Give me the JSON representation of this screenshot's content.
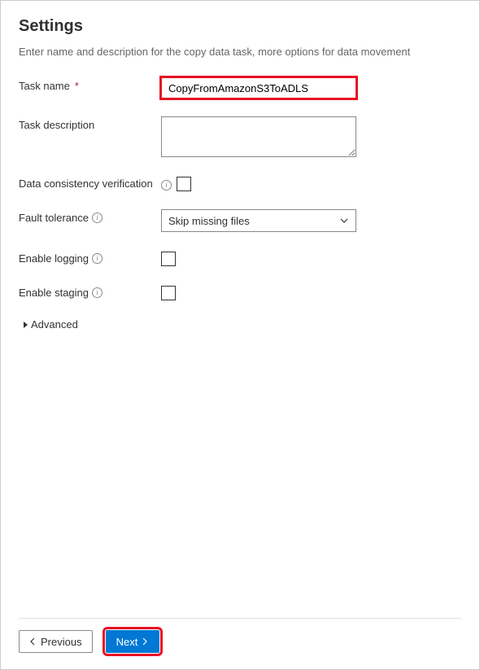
{
  "header": {
    "title": "Settings",
    "subtitle": "Enter name and description for the copy data task, more options for data movement"
  },
  "fields": {
    "taskName": {
      "label": "Task name",
      "value": "CopyFromAmazonS3ToADLS"
    },
    "taskDescription": {
      "label": "Task description",
      "value": ""
    },
    "dataConsistency": {
      "label": "Data consistency verification",
      "checked": false
    },
    "faultTolerance": {
      "label": "Fault tolerance",
      "selected": "Skip missing files"
    },
    "enableLogging": {
      "label": "Enable logging",
      "checked": false
    },
    "enableStaging": {
      "label": "Enable staging",
      "checked": false
    },
    "advanced": {
      "label": "Advanced"
    }
  },
  "footer": {
    "previous": "Previous",
    "next": "Next"
  }
}
